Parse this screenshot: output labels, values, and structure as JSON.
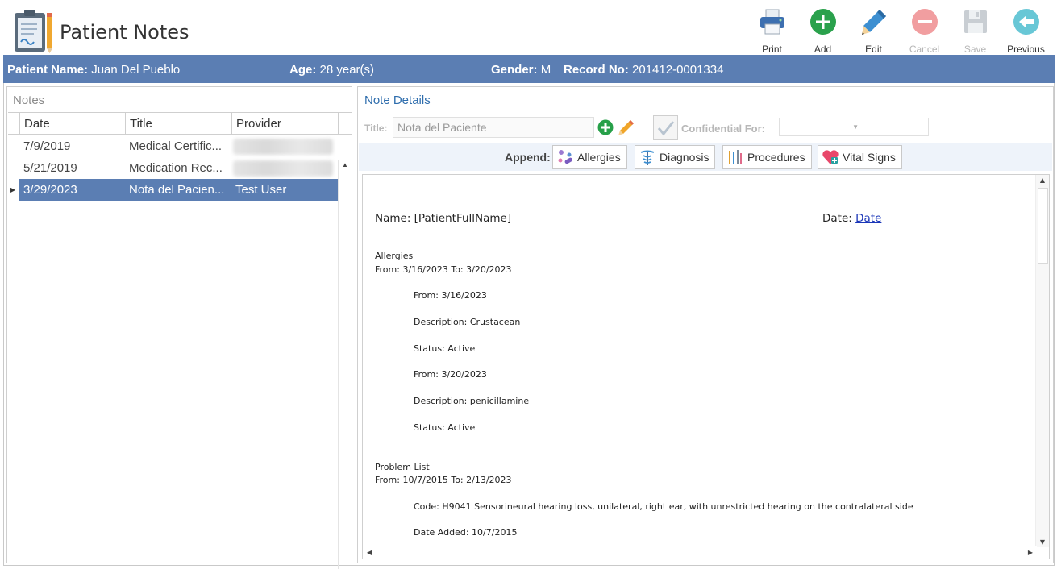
{
  "app": {
    "title": "Patient Notes"
  },
  "toolbar": {
    "print": "Print",
    "add": "Add",
    "edit": "Edit",
    "cancel": "Cancel",
    "save": "Save",
    "previous": "Previous"
  },
  "patient": {
    "name_label": "Patient Name:",
    "name": "Juan Del Pueblo",
    "age_label": "Age:",
    "age": "28 year(s)",
    "gender_label": "Gender:",
    "gender": "M",
    "record_label": "Record No:",
    "record": "201412-0001334"
  },
  "notes": {
    "title": "Notes",
    "columns": [
      "Date",
      "Title",
      "Provider"
    ],
    "rows": [
      {
        "date": "7/9/2019",
        "title": "Medical Certific...",
        "provider": ""
      },
      {
        "date": "5/21/2019",
        "title": "Medication Rec...",
        "provider": ""
      },
      {
        "date": "3/29/2023",
        "title": "Nota del Pacien...",
        "provider": "Test User"
      }
    ]
  },
  "details": {
    "title": "Note Details",
    "title_label": "Title:",
    "title_value": "Nota del Paciente",
    "confidential_label": "Confidential For:",
    "append_label": "Append:",
    "append_buttons": [
      "Allergies",
      "Diagnosis",
      "Procedures",
      "Vital Signs"
    ]
  },
  "document": {
    "name_line": "Name: [PatientFullName]",
    "date_label": "Date: ",
    "date_link": "Date",
    "allergies_heading": "Allergies",
    "allergies_range": "From: 3/16/2023 To: 3/20/2023",
    "a1_from": "From: 3/16/2023",
    "a1_desc": "Description: Crustacean",
    "a1_status": "Status: Active",
    "a2_from": "From: 3/20/2023",
    "a2_desc": "Description: penicillamine",
    "a2_status": "Status: Active",
    "problems_heading": "Problem List",
    "problems_range": "From: 10/7/2015 To: 2/13/2023",
    "p1_code": "Code: H9041 Sensorineural hearing loss, unilateral, right ear, with unrestricted hearing on the contralateral side",
    "p1_added": "Date Added: 10/7/2015"
  },
  "colors": {
    "accent": "#5b7eb3",
    "title_blue": "#2e6dad",
    "add_green": "#27ae60",
    "cancel_red": "#e57373"
  }
}
